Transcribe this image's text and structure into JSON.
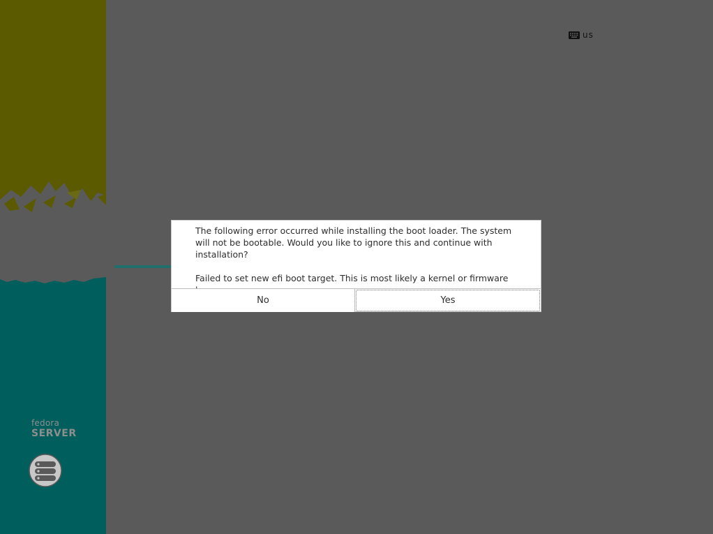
{
  "sidebar": {
    "brand_small": "fedora",
    "brand_big": "SERVER",
    "logo_icon": "fedora-server-icon",
    "colors": {
      "top": "#5b5a00",
      "bottom": "#005e5c",
      "middle": "#5a5a5a"
    }
  },
  "keyboard": {
    "icon": "keyboard-icon",
    "layout": "us"
  },
  "progress": {
    "fraction": 0.14,
    "color": "#1f6f6d"
  },
  "dialog": {
    "message": "The following error occurred while installing the boot loader. The system will not be bootable. Would you like to ignore this and continue with installation?",
    "detail": "Failed to set new efi boot target. This is most likely a kernel or firmware bug.",
    "buttons": {
      "no": "No",
      "yes": "Yes"
    }
  }
}
